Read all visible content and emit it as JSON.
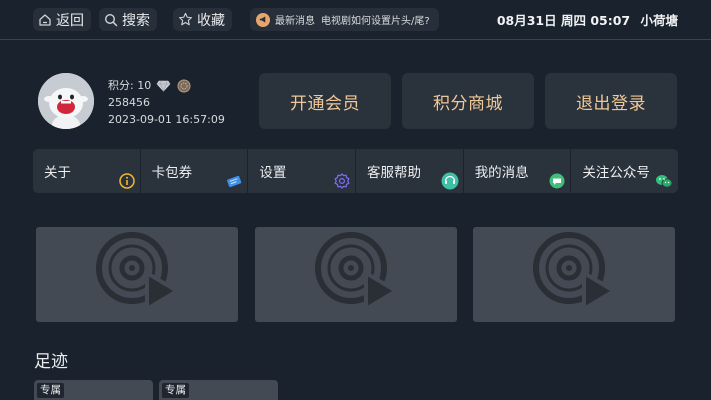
{
  "topbar": {
    "back_label": "返回",
    "search_label": "搜索",
    "favorites_label": "收藏",
    "news_label": "最新消息",
    "news_text": "电视剧如何设置片头/尾?",
    "datetime": "08月31日 周四 05:07",
    "user_name": "小荷塘"
  },
  "user": {
    "points_label": "积分: 10",
    "user_id": "258456",
    "registered": "2023-09-01 16:57:09"
  },
  "actions": {
    "vip": "开通会员",
    "shop": "积分商城",
    "logout": "退出登录"
  },
  "menu": [
    {
      "label": "关于",
      "icon": "info-icon"
    },
    {
      "label": "卡包券",
      "icon": "ticket-icon"
    },
    {
      "label": "设置",
      "icon": "settings-icon"
    },
    {
      "label": "客服帮助",
      "icon": "support-icon"
    },
    {
      "label": "我的消息",
      "icon": "message-icon"
    },
    {
      "label": "关注公众号",
      "icon": "wechat-icon"
    }
  ],
  "history": {
    "title": "足迹",
    "tag": "专属"
  },
  "colors": {
    "background": "#19222d",
    "panel": "#2a323c",
    "accent_text": "#f0c898",
    "card": "#434a53"
  }
}
